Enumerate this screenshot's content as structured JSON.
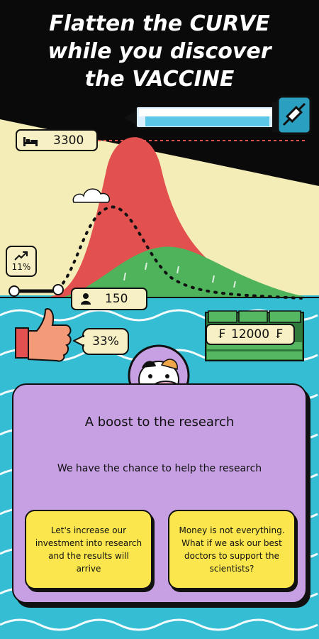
{
  "title": {
    "line1": "Flatten the CURVE",
    "line2": "while you discover",
    "line3": "the VACCINE"
  },
  "stats": {
    "hospital_beds": "3300",
    "infection_rate": "11%",
    "people": "150",
    "approval": "33%",
    "money": "12000"
  },
  "currency_symbol": "₣",
  "icons": {
    "bed": "bed-icon",
    "trend": "trending-up-icon",
    "person": "person-icon",
    "thumbs": "thumbs-up-icon",
    "syringe": "syringe-icon",
    "money": "money-stack-icon",
    "character": "cow-avatar-icon"
  },
  "card": {
    "title": "A boost to the research",
    "body": "We have the chance to help the research",
    "option_left": "Let's increase our investment into research and the results will arrive",
    "option_right": "Money is not everything. What if we ask our best doctors to support the scientists?"
  },
  "colors": {
    "sky": "#f5edb8",
    "night": "#0a0a0a",
    "sea": "#34bdd3",
    "red_curve": "#e2504f",
    "green_curve": "#4fb35b",
    "card": "#c7a0e3",
    "button": "#fbe74d"
  }
}
